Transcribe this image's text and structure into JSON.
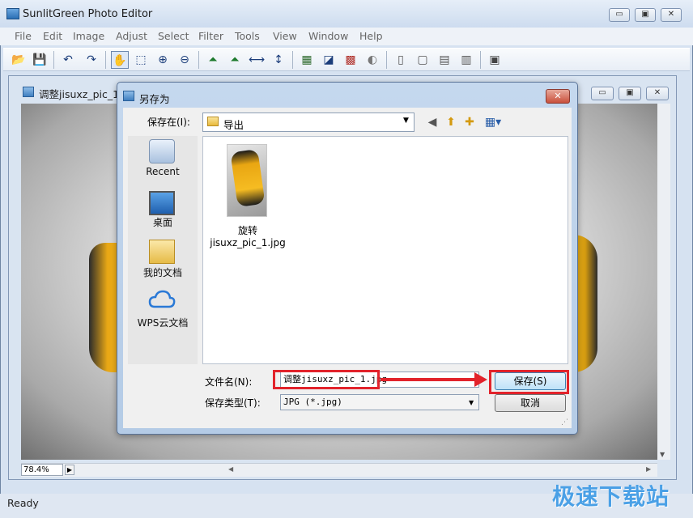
{
  "app": {
    "title": "SunlitGreen Photo Editor",
    "window_buttons": {
      "minimize": "▭",
      "maximize": "▣",
      "close": "✕"
    }
  },
  "menu": [
    "File",
    "Edit",
    "Image",
    "Adjust",
    "Select",
    "Filter",
    "Tools",
    "View",
    "Window",
    "Help"
  ],
  "toolbar": [
    {
      "icon": "open-folder-icon",
      "glyph": "📂"
    },
    {
      "icon": "save-icon",
      "glyph": "💾"
    },
    {
      "icon": "undo-icon",
      "glyph": "↶"
    },
    {
      "icon": "redo-icon",
      "glyph": "↷"
    },
    {
      "icon": "hand-icon",
      "glyph": "✋"
    },
    {
      "icon": "marquee-select-icon",
      "glyph": "⬚"
    },
    {
      "icon": "zoom-in-icon",
      "glyph": "⊕"
    },
    {
      "icon": "zoom-out-icon",
      "glyph": "⊖"
    },
    {
      "icon": "flip-horizontal-icon",
      "glyph": "⏶"
    },
    {
      "icon": "flip-vertical-icon",
      "glyph": "⏶"
    },
    {
      "icon": "resize-width-icon",
      "glyph": "⟷"
    },
    {
      "icon": "resize-height-icon",
      "glyph": "↕"
    },
    {
      "icon": "levels-icon",
      "glyph": "▦"
    },
    {
      "icon": "curves-icon",
      "glyph": "◪"
    },
    {
      "icon": "color-balance-icon",
      "glyph": "▩"
    },
    {
      "icon": "brightness-icon",
      "glyph": "◐"
    },
    {
      "icon": "frame-left-icon",
      "glyph": "▯"
    },
    {
      "icon": "frame-icon",
      "glyph": "▢"
    },
    {
      "icon": "text-frame-icon",
      "glyph": "▤"
    },
    {
      "icon": "text-frame-2-icon",
      "glyph": "▥"
    },
    {
      "icon": "fullscreen-icon",
      "glyph": "▣"
    }
  ],
  "document": {
    "title": "调整jisuxz_pic_1.j",
    "zoom": "78.4%"
  },
  "status": {
    "text": "Ready"
  },
  "watermark": "极速下载站",
  "dialog": {
    "title": "另存为",
    "close_glyph": "✕",
    "save_in_label": "保存在(I):",
    "save_in_value": "导出",
    "nav": {
      "back": "◀",
      "up": "⬆",
      "new_folder": "✚",
      "view": "▦▾"
    },
    "places": [
      {
        "label": "Recent",
        "icon": "recent-icon"
      },
      {
        "label": "桌面",
        "icon": "desktop-icon"
      },
      {
        "label": "我的文档",
        "icon": "documents-folder-icon"
      },
      {
        "label": "WPS云文档",
        "icon": "cloud-icon"
      }
    ],
    "file": {
      "line1": "旋转",
      "line2": "jisuxz_pic_1.jpg"
    },
    "filename_label": "文件名(N):",
    "filename_value": "调整jisuxz_pic_1.jpg",
    "filetype_label": "保存类型(T):",
    "filetype_value": "JPG (*.jpg)",
    "save_button": "保存(S)",
    "cancel_button": "取消"
  }
}
